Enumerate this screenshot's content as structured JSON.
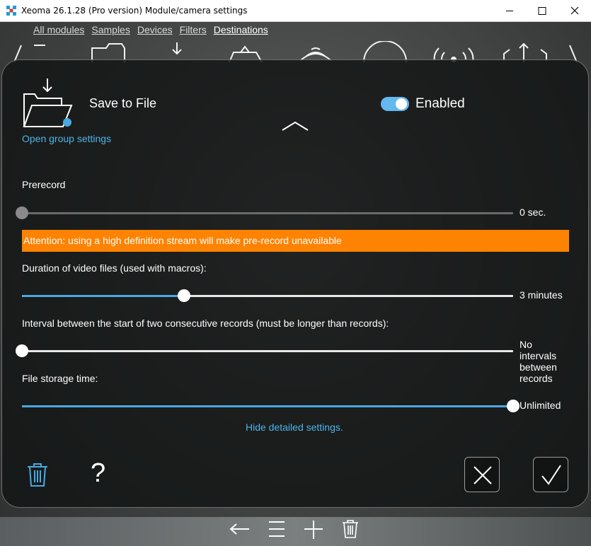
{
  "window": {
    "title": "Xeoma 26.1.28 (Pro version) Module/camera settings"
  },
  "top_menu": [
    {
      "label": "All modules"
    },
    {
      "label": "Samples"
    },
    {
      "label": "Devices"
    },
    {
      "label": "Filters"
    },
    {
      "label": "Destinations",
      "active": true
    }
  ],
  "module": {
    "name": "Save to File",
    "enabled_label": "Enabled",
    "enabled": true,
    "group_link": "Open group settings"
  },
  "prerecord": {
    "label": "Prerecord",
    "value": "0 sec.",
    "level": 0,
    "warning": "Attention: using a high definition stream will make pre-record unavailable"
  },
  "duration": {
    "label": "Duration of video files (used with macros):",
    "value": "3 minutes",
    "level": 0.33
  },
  "interval": {
    "label": "Interval between the start of two consecutive records (must be longer than records):",
    "value_lines": [
      "No",
      "intervals",
      "between",
      "records"
    ],
    "level": 0
  },
  "storage": {
    "label": "File storage time:",
    "value": "Unlimited",
    "level": 1
  },
  "hide_link": "Hide detailed settings.",
  "actions": {
    "help": "?"
  },
  "colors": {
    "accent": "#4fb3ea",
    "warning": "#fe8302",
    "toggle": "#63b8ee"
  }
}
